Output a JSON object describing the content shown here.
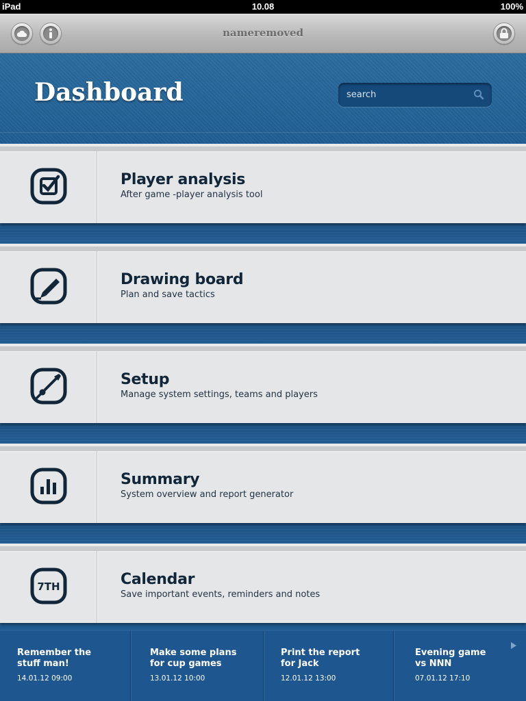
{
  "status_bar": {
    "device": "iPad",
    "time": "10.08",
    "battery": "100%"
  },
  "toolbar": {
    "title": "nameremoved",
    "left_buttons": [
      {
        "icon": "cloud-icon"
      },
      {
        "icon": "info-icon"
      }
    ],
    "right_buttons": [
      {
        "icon": "lock-icon"
      }
    ]
  },
  "header": {
    "title": "Dashboard",
    "search": {
      "placeholder": "search",
      "value": ""
    }
  },
  "menu": [
    {
      "icon": "checkbox-icon",
      "title": "Player analysis",
      "subtitle": "After game -player analysis tool"
    },
    {
      "icon": "pencil-icon",
      "title": "Drawing board",
      "subtitle": "Plan and save tactics"
    },
    {
      "icon": "screwdriver-icon",
      "title": "Setup",
      "subtitle": "Manage system settings, teams and players"
    },
    {
      "icon": "bar-chart-icon",
      "title": "Summary",
      "subtitle": "System overview and report generator"
    },
    {
      "icon": "calendar-7th-icon",
      "title": "Calendar",
      "subtitle": "Save important events, reminders and notes",
      "icon_text": "7TH"
    }
  ],
  "notes": [
    {
      "title": "Remember the\nstuff man!",
      "date": "14.01.12 09:00"
    },
    {
      "title": "Make some plans\nfor cup games",
      "date": "13.01.12 10:00"
    },
    {
      "title": "Print the report\nfor Jack",
      "date": "12.01.12 13:00"
    },
    {
      "title": "Evening game\nvs NNN",
      "date": "07.01.12 17:10"
    }
  ],
  "colors": {
    "header_blue": "#1f5d92",
    "menu_bg": "#e4e6e8",
    "text_dark": "#112638",
    "toolbar_gray": "#b9b9b9"
  }
}
